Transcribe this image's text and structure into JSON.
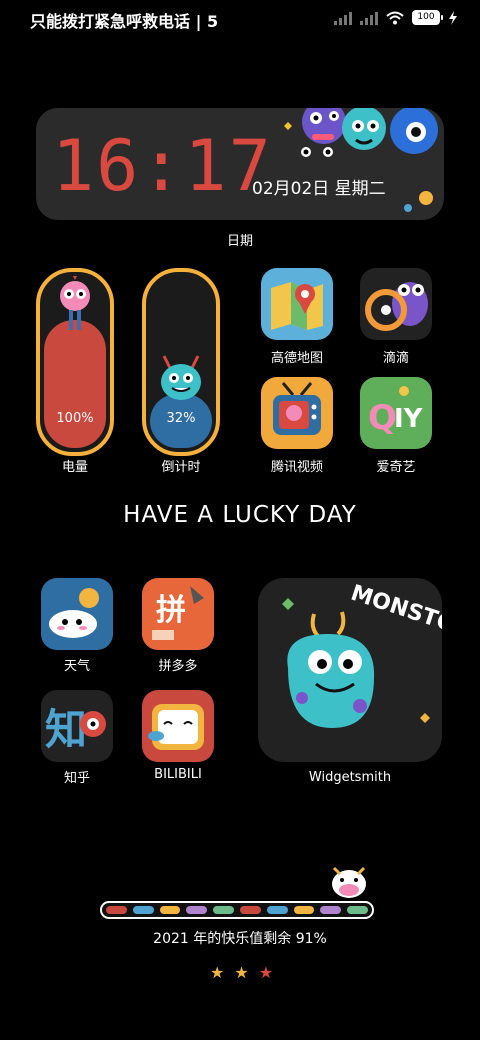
{
  "status_bar": {
    "carrier_text": "只能拨打紧急呼救电话 | 5",
    "battery_level": "100"
  },
  "clock_widget": {
    "time": "16:17",
    "date": "02月02日  星期二",
    "caption": "日期"
  },
  "battery_widget": {
    "value": "100%",
    "label": "电量",
    "fill_fraction": 1.0,
    "fill_color": "#c9493f"
  },
  "countdown_widget": {
    "value": "32%",
    "label": "倒计时",
    "fill_fraction": 0.32,
    "fill_color": "#2f6ea3"
  },
  "apps_top": [
    {
      "name": "高德地图",
      "icon": "amap-icon"
    },
    {
      "name": "滴滴",
      "icon": "didi-icon"
    },
    {
      "name": "腾讯视频",
      "icon": "tencent-video-icon"
    },
    {
      "name": "爱奇艺",
      "icon": "iqiyi-icon"
    }
  ],
  "headline": "HAVE A LUCKY DAY",
  "apps_bottom": [
    {
      "name": "天气",
      "icon": "weather-icon"
    },
    {
      "name": "拼多多",
      "icon": "pinduoduo-icon"
    },
    {
      "name": "知乎",
      "icon": "zhihu-icon"
    },
    {
      "name": "BILIBILI",
      "icon": "bilibili-icon"
    }
  ],
  "monster_widget": {
    "art_text": "MONSTOR",
    "label": "Widgetsmith"
  },
  "year_progress": {
    "text": "2021 年的快乐值剩余 91%",
    "remaining_percent": 91,
    "segment_colors": [
      "#c9493f",
      "#4fa3d1",
      "#f2b640",
      "#b084cc",
      "#6dbb8a",
      "#c9493f",
      "#4fa3d1",
      "#f2b640",
      "#b084cc",
      "#6dbb8a"
    ]
  },
  "stars": [
    {
      "glyph": "★",
      "color": "#f2b640"
    },
    {
      "glyph": "★",
      "color": "#f2b640"
    },
    {
      "glyph": "★",
      "color": "#d9493f"
    }
  ]
}
